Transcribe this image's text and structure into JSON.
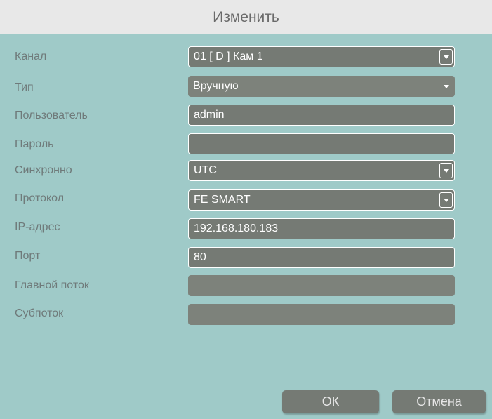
{
  "dialog": {
    "title": "Изменить"
  },
  "form": {
    "rows": [
      {
        "label": "Канал",
        "value": "01 [ D ] Кам 1"
      },
      {
        "label": "Тип",
        "value": "Вручную"
      },
      {
        "label": "Пользователь",
        "value": "admin"
      },
      {
        "label": "Пароль",
        "value": ""
      },
      {
        "label": "Синхронно",
        "value": "UTC"
      },
      {
        "label": "Протокол",
        "value": "FE SMART"
      },
      {
        "label": "IP-адрес",
        "value": "192.168.180.183"
      },
      {
        "label": "Порт",
        "value": "80"
      },
      {
        "label": "Главной поток",
        "value": ""
      },
      {
        "label": "Субпоток",
        "value": ""
      }
    ]
  },
  "buttons": {
    "ok": "ОК",
    "cancel": "Отмена"
  },
  "icons": {
    "dropdown": "chevron-down-icon"
  }
}
